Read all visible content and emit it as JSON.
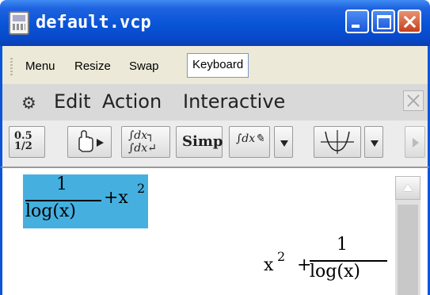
{
  "window": {
    "title": "default.vcp"
  },
  "menubar": {
    "items": [
      "Menu",
      "Resize",
      "Swap",
      "Keyboard"
    ]
  },
  "commandbar": {
    "items": [
      "Edit",
      "Action",
      "Interactive"
    ]
  },
  "toolbar": {
    "simp_label": "Simp",
    "convert_top": "0.5",
    "convert_frac": "1/2"
  },
  "work": {
    "input": {
      "numerator": "1",
      "denominator": "log(x)",
      "plus": "+x",
      "exponent": "2"
    },
    "output": {
      "base": "x",
      "exponent": "2",
      "plus": "+",
      "numerator": "1",
      "denominator": "log(x)"
    }
  },
  "colors": {
    "title_blue": "#0a55d8",
    "selection": "#45b0e0",
    "close_red": "#c5401e"
  }
}
